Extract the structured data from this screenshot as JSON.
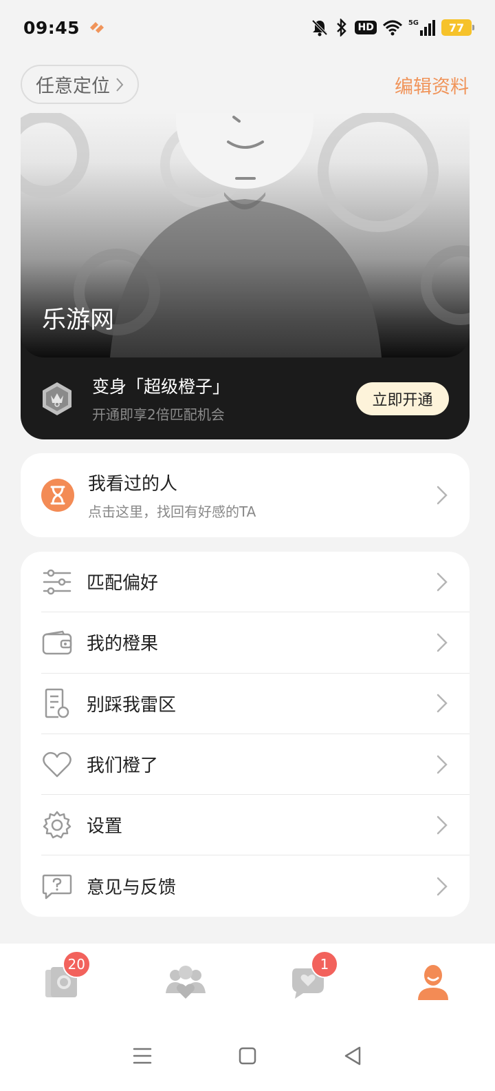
{
  "status_bar": {
    "time": "09:45",
    "hd_label": "HD",
    "network_label": "5G",
    "battery_level": "77"
  },
  "header": {
    "location_label": "任意定位",
    "edit_profile_label": "编辑资料"
  },
  "profile": {
    "nickname": "乐游网",
    "vip_title": "变身「超级橙子」",
    "vip_subtitle": "开通即享2倍匹配机会",
    "vip_button_label": "立即开通"
  },
  "viewed": {
    "title": "我看过的人",
    "subtitle": "点击这里，找回有好感的TA"
  },
  "menu": {
    "items": [
      {
        "label": "匹配偏好",
        "icon": "sliders-icon"
      },
      {
        "label": "我的橙果",
        "icon": "wallet-icon"
      },
      {
        "label": "别踩我雷区",
        "icon": "document-icon"
      },
      {
        "label": "我们橙了",
        "icon": "heart-icon"
      },
      {
        "label": "设置",
        "icon": "gear-icon"
      },
      {
        "label": "意见与反馈",
        "icon": "feedback-icon"
      }
    ]
  },
  "bottom_nav": {
    "items": [
      {
        "name": "cards",
        "icon": "photo-cards-icon",
        "badge": "20"
      },
      {
        "name": "community",
        "icon": "people-heart-icon",
        "badge": ""
      },
      {
        "name": "messages",
        "icon": "chat-heart-icon",
        "badge": "1"
      },
      {
        "name": "profile",
        "icon": "person-icon",
        "badge": ""
      }
    ]
  },
  "colors": {
    "accent": "#f0945a",
    "badge": "#f2625c",
    "vip_button_bg": "#fdf3da",
    "profile_active": "#f38b55"
  }
}
